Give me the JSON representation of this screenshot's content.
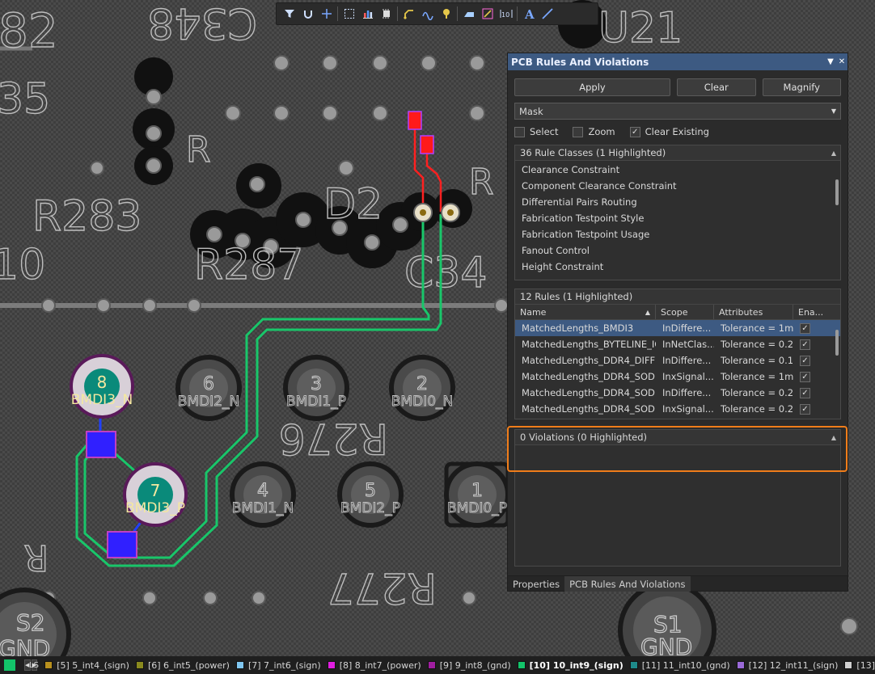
{
  "toolbar": {
    "icons": [
      "filter-icon",
      "route-icon",
      "crosshair-icon",
      "select-rect-icon",
      "chart-icon",
      "component-icon",
      "interactive-route-icon",
      "diff-pair-icon",
      "via-icon",
      "polygon-icon",
      "fill-icon",
      "dimension-icon",
      "text-icon",
      "line-icon"
    ]
  },
  "pcb": {
    "silk_labels": [
      "82",
      "C348",
      "U21",
      "35",
      "R283",
      "10",
      "R287",
      "D2",
      "C34",
      "R276",
      "R277",
      "R",
      "R",
      "R"
    ],
    "pads": [
      {
        "num": "8",
        "net": "BMDI3_N"
      },
      {
        "num": "6",
        "net": "BMDI2_N"
      },
      {
        "num": "3",
        "net": "BMDI1_P"
      },
      {
        "num": "2",
        "net": "BMDI0_N"
      },
      {
        "num": "7",
        "net": "BMDI3_P"
      },
      {
        "num": "4",
        "net": "BMDI1_N"
      },
      {
        "num": "5",
        "net": "BMDI2_P"
      },
      {
        "num": "1",
        "net": "BMDI0_P"
      }
    ],
    "corner_pads": [
      {
        "name": "S2",
        "net": "GND"
      },
      {
        "name": "S1",
        "net": "GND"
      }
    ]
  },
  "panel": {
    "title": "PCB Rules And Violations",
    "buttons": {
      "apply": "Apply",
      "clear": "Clear",
      "magnify": "Magnify"
    },
    "mode": {
      "selected": "Mask"
    },
    "checkboxes": [
      {
        "label": "Select",
        "checked": false
      },
      {
        "label": "Zoom",
        "checked": false
      },
      {
        "label": "Clear Existing",
        "checked": true
      }
    ],
    "rule_classes": {
      "header": "36 Rule Classes (1 Highlighted)",
      "items": [
        "Clearance Constraint",
        "Component Clearance Constraint",
        "Differential Pairs Routing",
        "Fabrication Testpoint Style",
        "Fabrication Testpoint Usage",
        "Fanout Control",
        "Height Constraint"
      ]
    },
    "rules": {
      "header": "12 Rules (1 Highlighted)",
      "columns": {
        "name": "Name",
        "scope": "Scope",
        "attributes": "Attributes",
        "enabled": "Ena..."
      },
      "rows": [
        {
          "name": "MatchedLengths_BMDI3",
          "scope": "InDiffere...",
          "attr": "Tolerance = 1m...",
          "enabled": true,
          "selected": true
        },
        {
          "name": "MatchedLengths_BYTELINE_IC...",
          "scope": "InNetClas...",
          "attr": "Tolerance = 0.2...",
          "enabled": true,
          "selected": false
        },
        {
          "name": "MatchedLengths_DDR4_DIFF",
          "scope": "InDiffere...",
          "attr": "Tolerance = 0.1...",
          "enabled": true,
          "selected": false
        },
        {
          "name": "MatchedLengths_DDR4_SODI...",
          "scope": "InxSignal...",
          "attr": "Tolerance = 1mm",
          "enabled": true,
          "selected": false
        },
        {
          "name": "MatchedLengths_DDR4_SODI...",
          "scope": "InDiffere...",
          "attr": "Tolerance = 0.2...",
          "enabled": true,
          "selected": false
        },
        {
          "name": "MatchedLengths_DDR4_SODI...",
          "scope": "InxSignal...",
          "attr": "Tolerance = 0.2...",
          "enabled": true,
          "selected": false
        }
      ]
    },
    "violations": {
      "header": "0 Violations (0 Highlighted)"
    },
    "tabs": [
      "Properties",
      "PCB Rules And Violations"
    ]
  },
  "statusbar": {
    "ls_label": "LS",
    "layers": [
      {
        "label": "[5] 5_int4_(sign)",
        "color": "#b8901e"
      },
      {
        "label": "[6] 6_int5_(power)",
        "color": "#8a8a1e"
      },
      {
        "label": "[7] 7_int6_(sign)",
        "color": "#7fc6f0"
      },
      {
        "label": "[8] 8_int7_(power)",
        "color": "#e01ee0"
      },
      {
        "label": "[9] 9_int8_(gnd)",
        "color": "#a01ea0"
      },
      {
        "label": "[10] 10_int9_(sign)",
        "color": "#13c46a",
        "active": true
      },
      {
        "label": "[11] 11_int10_(gnd)",
        "color": "#1e8a8a"
      },
      {
        "label": "[12] 12_int11_(sign)",
        "color": "#9a6ad8"
      },
      {
        "label": "[13]",
        "color": "#d0d0d0"
      }
    ]
  }
}
